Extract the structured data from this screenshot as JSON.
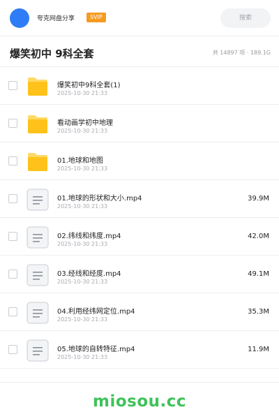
{
  "header": {
    "brand": "夸克网盘分享",
    "badge": "SVIP",
    "search_label": "搜索"
  },
  "title_bar": {
    "title": "爆笑初中 9科全套",
    "stats": "共 14897 项 · 189.1G"
  },
  "files": [
    {
      "type": "folder",
      "icon": "folder-icon",
      "name": "爆笑初中9科全套(1)",
      "date": "2025-10-30 21:33",
      "size": ""
    },
    {
      "type": "folder",
      "icon": "folder-icon",
      "name": "看动画学初中地理",
      "date": "2025-10-30 21:33",
      "size": ""
    },
    {
      "type": "folder",
      "icon": "folder-icon",
      "name": "01.地球和地图",
      "date": "2025-10-30 21:33",
      "size": ""
    },
    {
      "type": "file",
      "icon": "document-icon",
      "name": "01.地球的形状和大小.mp4",
      "date": "2025-10-30 21:33",
      "size": "39.9M"
    },
    {
      "type": "file",
      "icon": "document-icon",
      "name": "02.纬线和纬度.mp4",
      "date": "2025-10-30 21:33",
      "size": "42.0M"
    },
    {
      "type": "file",
      "icon": "document-icon",
      "name": "03.经线和经度.mp4",
      "date": "2025-10-30 21:33",
      "size": "49.1M"
    },
    {
      "type": "file",
      "icon": "document-icon",
      "name": "04.利用经纬网定位.mp4",
      "date": "2025-10-30 21:33",
      "size": "35.3M"
    },
    {
      "type": "file",
      "icon": "document-icon",
      "name": "05.地球的自转特征.mp4",
      "date": "2025-10-30 21:33",
      "size": "11.9M"
    }
  ],
  "watermark": "miosou.cc",
  "colors": {
    "avatar": "#2f7df6",
    "badge": "#f59b22",
    "folder": "#ffc21a",
    "watermark": "#3fc25a"
  }
}
